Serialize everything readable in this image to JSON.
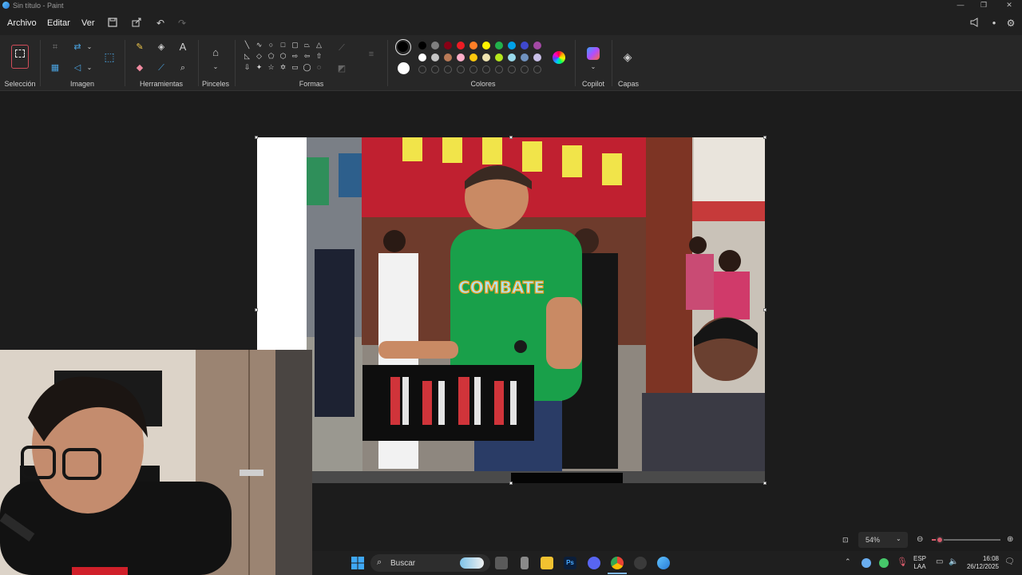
{
  "window": {
    "title": "Sin título - Paint"
  },
  "menu": {
    "file": "Archivo",
    "edit": "Editar",
    "view": "Ver"
  },
  "ribbon": {
    "groups": {
      "selection": "Selección",
      "image": "Imagen",
      "tools": "Herramientas",
      "brushes": "Pinceles",
      "shapes": "Formas",
      "colors": "Colores",
      "copilot": "Copilot",
      "layers": "Capas"
    },
    "palette_row1": [
      "#000000",
      "#7f7f7f",
      "#880015",
      "#ed1c24",
      "#ff7f27",
      "#fff200",
      "#22b14c",
      "#00a2e8",
      "#3f48cc",
      "#a349a4"
    ],
    "palette_row2": [
      "#ffffff",
      "#c3c3c3",
      "#b97a57",
      "#ffaec9",
      "#ffc90e",
      "#efe4b0",
      "#b5e61d",
      "#99d9ea",
      "#7092be",
      "#c8bfe7"
    ],
    "primary_color": "#000000",
    "secondary_color": "#ffffff"
  },
  "status": {
    "zoom": "54%",
    "zoom_fraction": 0.12
  },
  "taskbar": {
    "search_placeholder": "Buscar",
    "language": "ESP",
    "layout": "LAA",
    "time": "16:08",
    "date": "26/12/2025",
    "ps_label": "Ps"
  },
  "photo": {
    "shirt_text": "COMBATE"
  }
}
